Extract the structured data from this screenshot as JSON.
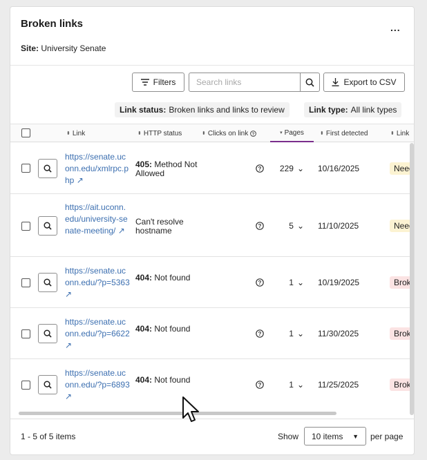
{
  "panel": {
    "title": "Broken links",
    "more_label": "...",
    "site_label": "Site:",
    "site_value": "University Senate"
  },
  "toolbar": {
    "filters_label": "Filters",
    "search_placeholder": "Search links",
    "search_value": "",
    "export_label": "Export to CSV"
  },
  "chips": {
    "status_label": "Link status:",
    "status_value": "Broken links and links to review",
    "type_label": "Link type:",
    "type_value": "All link types"
  },
  "columns": {
    "link": "Link",
    "http": "HTTP status",
    "clicks": "Clicks on link",
    "pages": "Pages",
    "first": "First detected",
    "status": "Link"
  },
  "rows": [
    {
      "url": "https://senate.uconn.edu/xmlrpc.php",
      "code": "405:",
      "message": "Method Not Allowed",
      "pages": "229",
      "date": "10/16/2025",
      "badge": "Need"
    },
    {
      "url": "https://ait.uconn.edu/university-senate-meeting/",
      "code": "",
      "message": "Can't resolve hostname",
      "pages": "5",
      "date": "11/10/2025",
      "badge": "Need"
    },
    {
      "url": "https://senate.uconn.edu/?p=5363",
      "code": "404:",
      "message": "Not found",
      "pages": "1",
      "date": "10/19/2025",
      "badge": "Brok"
    },
    {
      "url": "https://senate.uconn.edu/?p=6622",
      "code": "404:",
      "message": "Not found",
      "pages": "1",
      "date": "11/30/2025",
      "badge": "Brok"
    },
    {
      "url": "https://senate.uconn.edu/?p=6893",
      "code": "404:",
      "message": "Not found",
      "pages": "1",
      "date": "11/25/2025",
      "badge": "Brok"
    }
  ],
  "footer": {
    "range": "1 - 5 of 5 items",
    "show_label": "Show",
    "page_size": "10 items",
    "per_page_label": "per page"
  },
  "colors": {
    "accent": "#7a2d8c",
    "link": "#3c6fb0",
    "needs_review_bg": "#fcf3d2",
    "broken_bg": "#fbe3e3"
  }
}
